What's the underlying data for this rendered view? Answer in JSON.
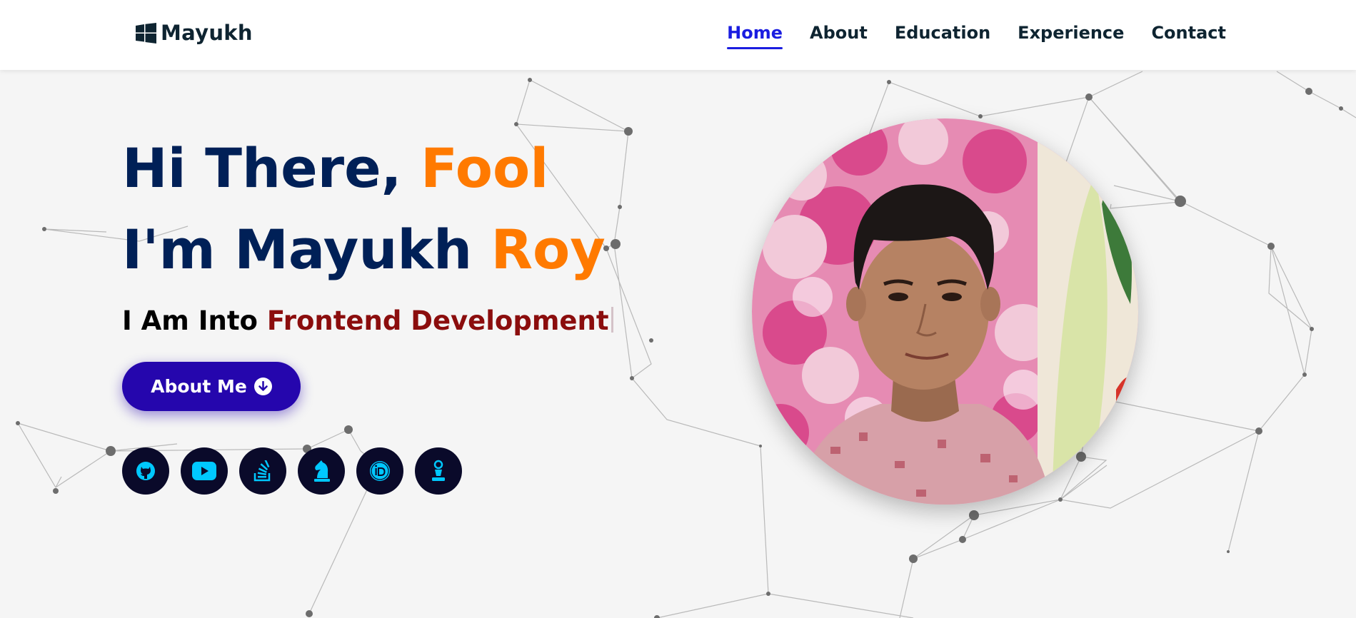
{
  "brand": {
    "name": "Mayukh",
    "icon": "windows-logo-icon"
  },
  "nav": {
    "items": [
      {
        "label": "Home",
        "active": true
      },
      {
        "label": "About",
        "active": false
      },
      {
        "label": "Education",
        "active": false
      },
      {
        "label": "Experience",
        "active": false
      },
      {
        "label": "Contact",
        "active": false
      }
    ]
  },
  "hero": {
    "line1_main": "Hi There, ",
    "line1_accent": "Fool",
    "line2_main": "I'm Mayukh ",
    "line2_accent": "Roy",
    "typed_prefix": "I Am Into ",
    "typed_role": "Frontend Development",
    "button_label": "About Me",
    "button_icon": "arrow-down-circle-icon"
  },
  "socials": [
    {
      "icon": "github-icon"
    },
    {
      "icon": "youtube-icon"
    },
    {
      "icon": "stackoverflow-icon"
    },
    {
      "icon": "chess-knight-icon"
    },
    {
      "icon": "orcid-icon"
    },
    {
      "icon": "chess-pawn-icon"
    }
  ],
  "colors": {
    "navy": "#002057",
    "accent_orange": "#ff7a00",
    "role_red": "#8b0d0d",
    "nav_active": "#1a1de0",
    "button": "#2506ad",
    "social_bg": "#0a0a2a",
    "social_icon": "#00c8ff"
  },
  "profile_image": {
    "alt": "profile photo"
  }
}
